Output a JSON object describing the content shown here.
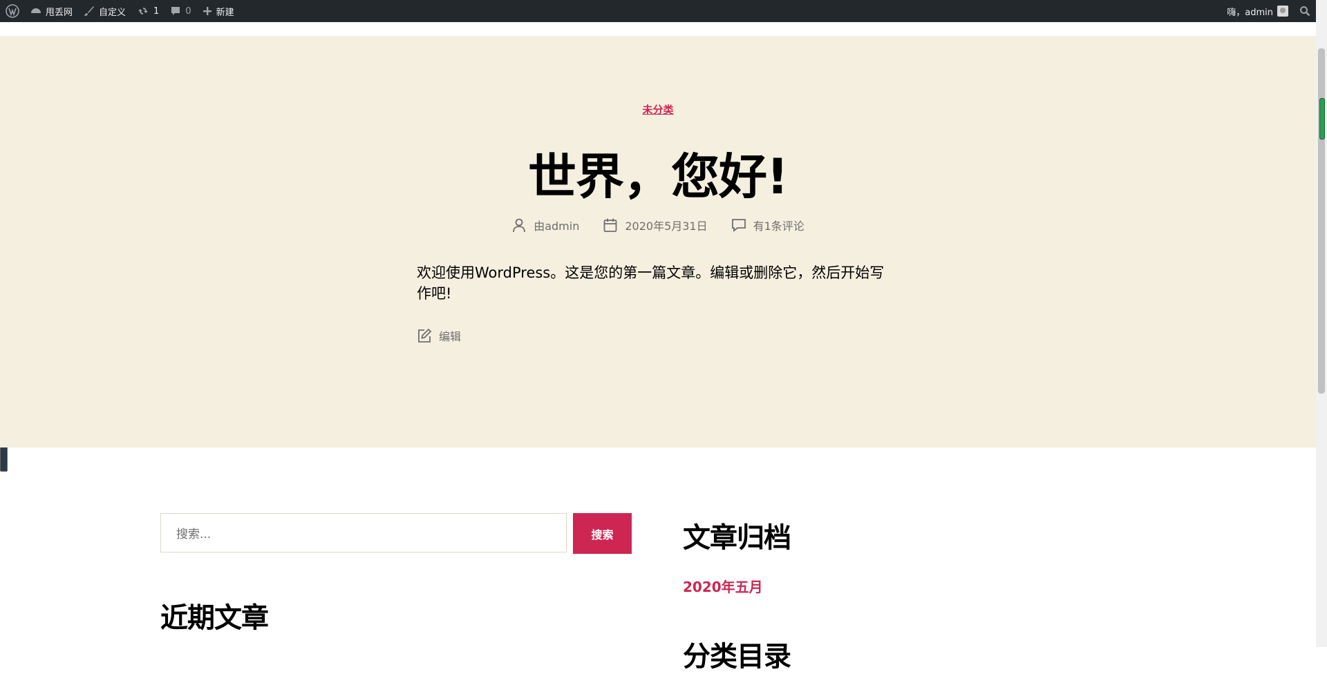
{
  "admin_bar": {
    "site_name": "甩丢网",
    "customize": "自定义",
    "updates_count": "1",
    "comments_count": "0",
    "new": "新建",
    "greeting": "嗨，admin"
  },
  "post": {
    "category": "未分类",
    "title": "世界，您好!",
    "author": "由admin",
    "date": "2020年5月31日",
    "comments": "有1条评论",
    "content_line1": "欢迎使用WordPress。这是您的第一篇文章。编辑或删除它，然后开始写",
    "content_line2": "作吧!",
    "edit": "编辑"
  },
  "widgets": {
    "search_placeholder": "搜索...",
    "search_button": "搜索",
    "recent_posts_title": "近期文章",
    "archives_title": "文章归档",
    "archive_item": "2020年五月",
    "categories_title": "分类目录"
  },
  "colors": {
    "accent": "#cd2653",
    "hero_bg": "#f5efe0",
    "admin_bar_bg": "#23282d"
  }
}
